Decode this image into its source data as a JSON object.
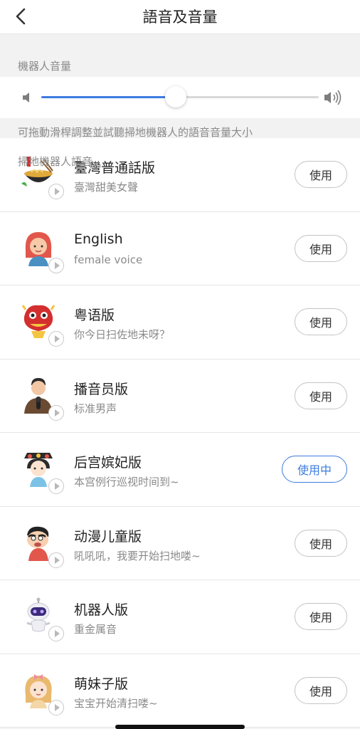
{
  "header": {
    "title": "語音及音量"
  },
  "volume": {
    "section_label": "機器人音量",
    "level": 0.485,
    "accent": "#3e7ce0",
    "hint": "可拖動滑桿調整並試聽掃地機器人的語音音量大小"
  },
  "voices": {
    "section_label": "掃地機器人語音",
    "items": [
      {
        "name": "臺灣普通話版",
        "desc": "臺灣甜美女聲",
        "button": "使用",
        "active": false,
        "avatar": "noodle-bowl-icon"
      },
      {
        "name": "English",
        "desc": "female voice",
        "button": "使用",
        "active": false,
        "avatar": "red-hair-girl-icon"
      },
      {
        "name": "粤语版",
        "desc": "你今日扫佐地未呀？",
        "button": "使用",
        "active": false,
        "avatar": "lion-dance-icon"
      },
      {
        "name": "播音员版",
        "desc": "标准男声",
        "button": "使用",
        "active": false,
        "avatar": "news-anchor-icon"
      },
      {
        "name": "后宫嫔妃版",
        "desc": "本宫例行巡视时间到~",
        "button": "使用中",
        "active": true,
        "avatar": "concubine-icon"
      },
      {
        "name": "动漫儿童版",
        "desc": "吼吼吼，我要开始扫地喽~",
        "button": "使用",
        "active": false,
        "avatar": "cartoon-boy-icon"
      },
      {
        "name": "机器人版",
        "desc": "重金属音",
        "button": "使用",
        "active": false,
        "avatar": "robot-icon"
      },
      {
        "name": "萌妹子版",
        "desc": "宝宝开始清扫喽~",
        "button": "使用",
        "active": false,
        "avatar": "cute-girl-icon"
      }
    ]
  }
}
